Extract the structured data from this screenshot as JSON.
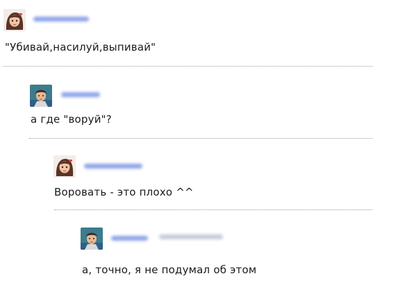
{
  "comments": [
    {
      "avatar": "girl-avatar-icon",
      "text": "\"Убивай,насилуй,выпивай\""
    },
    {
      "avatar": "man-avatar-icon",
      "text": "а где \"воруй\"?"
    },
    {
      "avatar": "girl-avatar-icon",
      "text": "Воровать - это плохо ^^"
    },
    {
      "avatar": "man-avatar-icon",
      "text": "а, точно, я не подумал об этом"
    }
  ]
}
